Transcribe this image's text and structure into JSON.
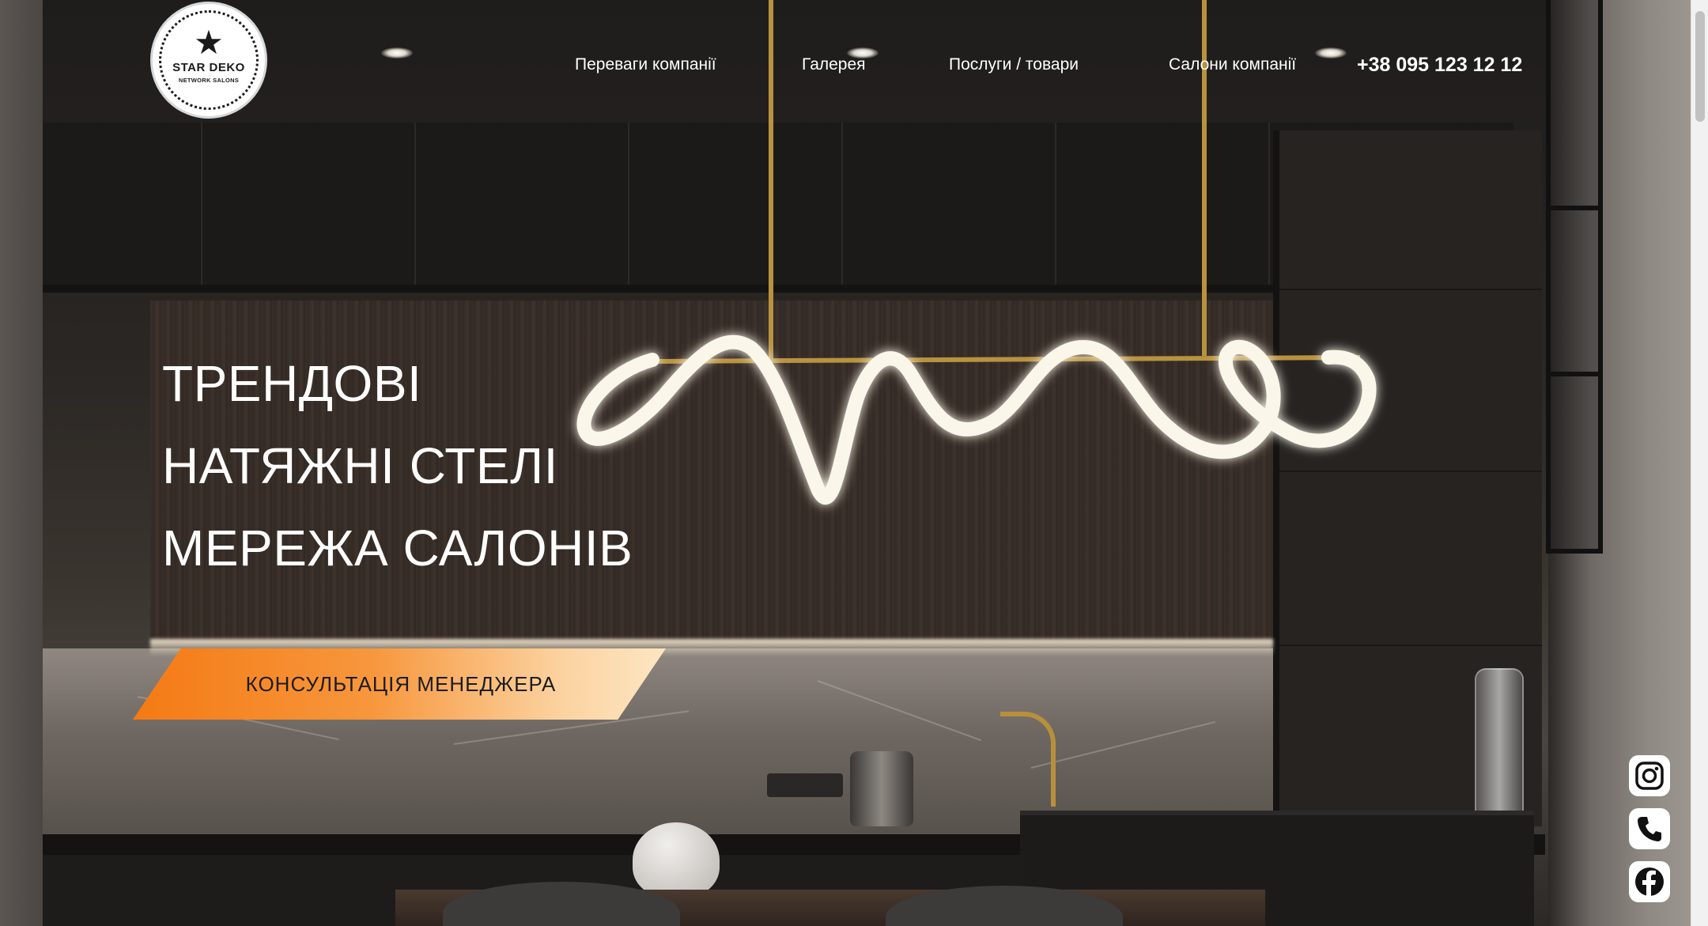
{
  "logo": {
    "title": "STAR DEKO",
    "subtitle": "NETWORK SALONS"
  },
  "nav": {
    "items": [
      {
        "label": "Переваги компанії"
      },
      {
        "label": "Галерея"
      },
      {
        "label": "Послуги / товари"
      },
      {
        "label": "Салони компанії"
      }
    ],
    "phone": "+38 095 123 12 12"
  },
  "hero": {
    "lines": [
      "ТРЕНДОВІ",
      "НАТЯЖНІ СТЕЛІ",
      "МЕРЕЖА САЛОНІВ"
    ],
    "cta_label": "КОНСУЛЬТАЦІЯ МЕНЕДЖЕРА"
  },
  "social": [
    {
      "icon": "instagram-icon"
    },
    {
      "icon": "phone-icon"
    },
    {
      "icon": "facebook-icon"
    }
  ],
  "colors": {
    "accent_start": "#f47a14",
    "accent_end": "#fde6c4",
    "text": "#ffffff"
  }
}
